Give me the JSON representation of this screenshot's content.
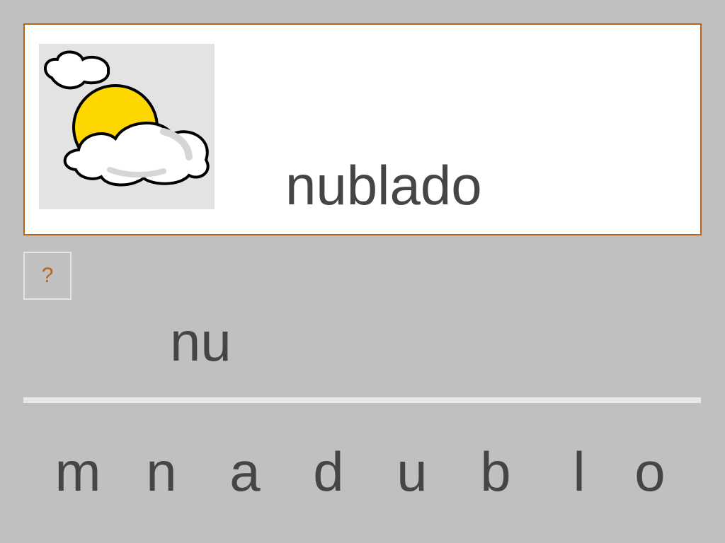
{
  "card": {
    "word": "nublado",
    "picture_icon": "sun-behind-clouds-icon"
  },
  "hint": {
    "label": "?"
  },
  "answer": {
    "text": "nu"
  },
  "letters": [
    "m",
    "n",
    "a",
    "d",
    "u",
    "b",
    "l",
    "o"
  ],
  "colors": {
    "background": "#c0c0c0",
    "card_border": "#b5651d",
    "text": "#454545",
    "hint_text": "#b5651d",
    "sun": "#ffd700"
  }
}
